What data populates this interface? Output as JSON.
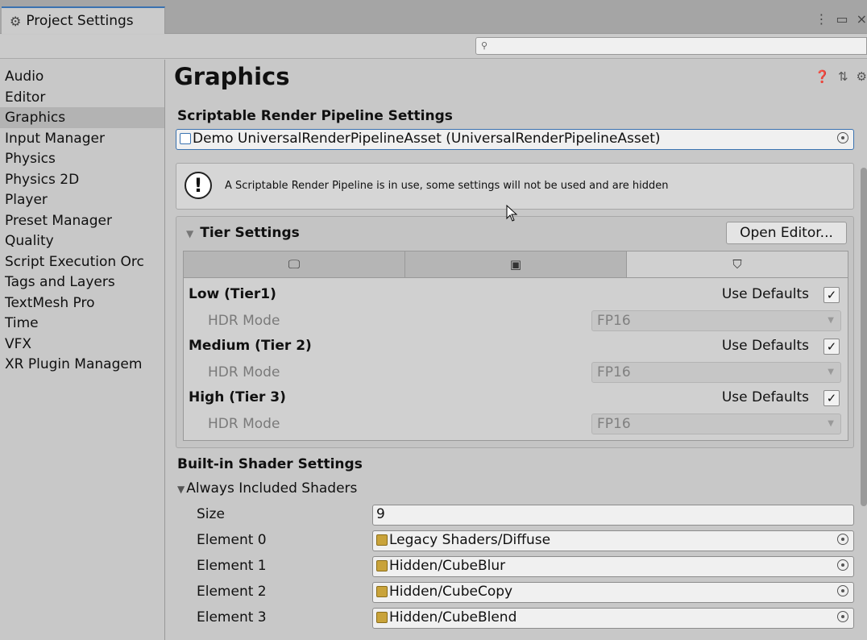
{
  "window": {
    "tab_title": "Project Settings",
    "search_placeholder": ""
  },
  "sidebar": {
    "items": [
      {
        "label": "Audio"
      },
      {
        "label": "Editor"
      },
      {
        "label": "Graphics"
      },
      {
        "label": "Input Manager"
      },
      {
        "label": "Physics"
      },
      {
        "label": "Physics 2D"
      },
      {
        "label": "Player"
      },
      {
        "label": "Preset Manager"
      },
      {
        "label": "Quality"
      },
      {
        "label": "Script Execution Orc"
      },
      {
        "label": "Tags and Layers"
      },
      {
        "label": "TextMesh Pro"
      },
      {
        "label": "Time"
      },
      {
        "label": "VFX"
      },
      {
        "label": "XR Plugin Managem"
      }
    ],
    "active": "Graphics"
  },
  "main": {
    "title": "Graphics",
    "srp": {
      "label": "Scriptable Render Pipeline Settings",
      "value": "Demo UniversalRenderPipelineAsset (UniversalRenderPipelineAsset)"
    },
    "help_text": "A Scriptable Render Pipeline is in use, some settings will not be used and are hidden",
    "tier_settings": {
      "label": "Tier Settings",
      "open_editor": "Open Editor...",
      "platform_tabs": [
        "monitor-icon",
        "android-icon",
        "html5-icon"
      ],
      "tiers": [
        {
          "name": "Low (Tier1)",
          "use_defaults": "Use Defaults",
          "checked": true,
          "hdr_label": "HDR Mode",
          "hdr_value": "FP16"
        },
        {
          "name": "Medium (Tier 2)",
          "use_defaults": "Use Defaults",
          "checked": true,
          "hdr_label": "HDR Mode",
          "hdr_value": "FP16"
        },
        {
          "name": "High (Tier 3)",
          "use_defaults": "Use Defaults",
          "checked": true,
          "hdr_label": "HDR Mode",
          "hdr_value": "FP16"
        }
      ]
    },
    "builtin": {
      "label": "Built-in Shader Settings",
      "always_included": "Always Included Shaders",
      "size_label": "Size",
      "size_value": "9",
      "elements": [
        {
          "label": "Element 0",
          "value": "Legacy Shaders/Diffuse"
        },
        {
          "label": "Element 1",
          "value": "Hidden/CubeBlur"
        },
        {
          "label": "Element 2",
          "value": "Hidden/CubeCopy"
        },
        {
          "label": "Element 3",
          "value": "Hidden/CubeBlend"
        }
      ]
    }
  }
}
